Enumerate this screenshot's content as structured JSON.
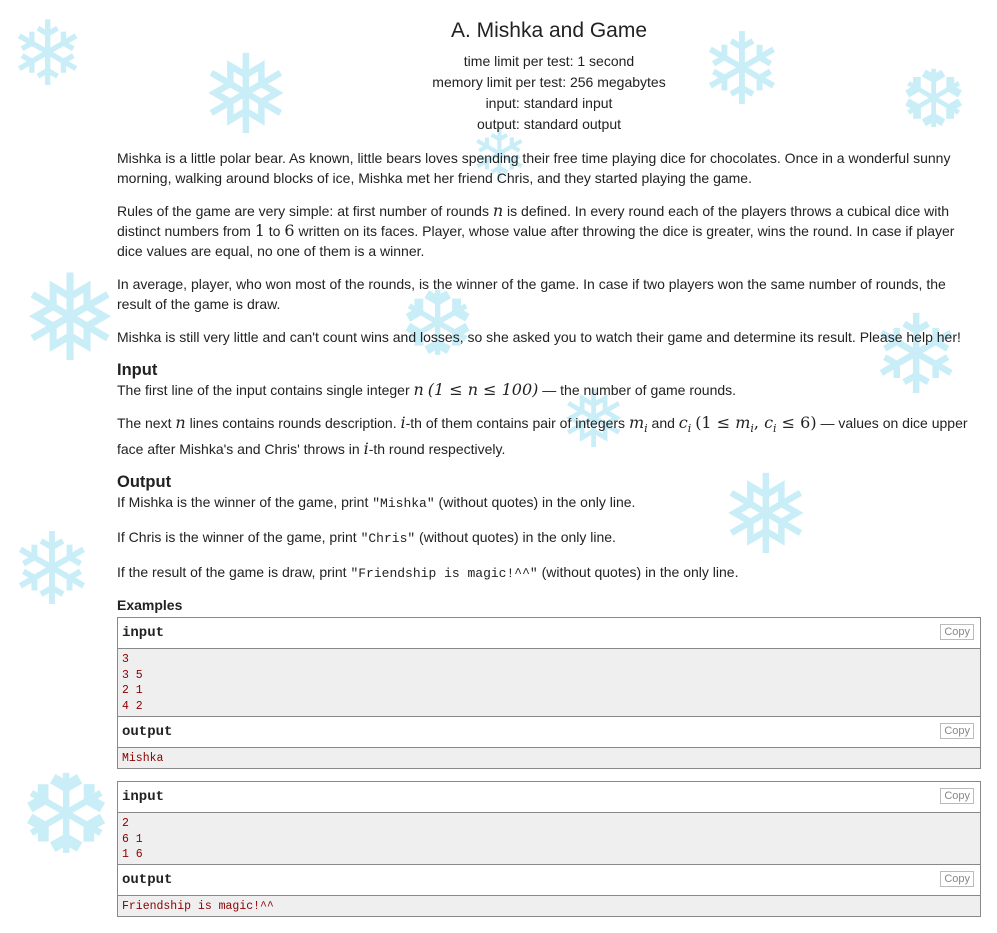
{
  "problem": {
    "title": "A. Mishka and Game",
    "limits": [
      "time limit per test: 1 second",
      "memory limit per test: 256 megabytes",
      "input: standard input",
      "output: standard output"
    ]
  },
  "statement": {
    "p1": "Mishka is a little polar bear. As known, little bears loves spending their free time playing dice for chocolates. Once in a wonderful sunny morning, walking around blocks of ice, Mishka met her friend Chris, and they started playing the game.",
    "p2a": "Rules of the game are very simple: at first number of rounds ",
    "p2b": " is defined. In every round each of the players throws a cubical dice with distinct numbers from ",
    "p2c": " to ",
    "p2d": " written on its faces. Player, whose value after throwing the dice is greater, wins the round. In case if player dice values are equal, no one of them is a winner.",
    "p3": "In average, player, who won most of the rounds, is the winner of the game. In case if two players won the same number of rounds, the result of the game is draw.",
    "p4": "Mishka is still very little and can't count wins and losses, so she asked you to watch their game and determine its result. Please help her!"
  },
  "math": {
    "n": "n",
    "one": "1",
    "six": "6",
    "n_range": "(1 ≤ n ≤ 100)",
    "i": "i",
    "mi": "m",
    "ci": "c",
    "sub_i": "i",
    "mc_range_a": "(1 ≤ ",
    "mc_range_b": ",  ",
    "mc_range_c": " ≤ 6)"
  },
  "input_section": {
    "title": "Input",
    "l1a": "The first line of the input contains single integer ",
    "l1b": " — the number of game rounds.",
    "l2a": "The next ",
    "l2b": " lines contains rounds description. ",
    "l2c": "-th of them contains pair of integers ",
    "l2d": " and ",
    "l2e": " — values on dice upper face after Mishka's and Chris' throws in ",
    "l2f": "-th round respectively."
  },
  "output_section": {
    "title": "Output",
    "o1a": "If Mishka is the winner of the game, print ",
    "o1code": "\"Mishka\"",
    "o1b": " (without quotes) in the only line.",
    "o2a": "If Chris is the winner of the game, print ",
    "o2code": "\"Chris\"",
    "o2b": " (without quotes) in the only line.",
    "o3a": "If the result of the game is draw, print ",
    "o3code": "\"Friendship is magic!^^\"",
    "o3b": " (without quotes) in the only line."
  },
  "examples": {
    "title": "Examples",
    "copy_label": "Copy",
    "input_label": "input",
    "output_label": "output",
    "ex1_input": [
      "3",
      "3 5",
      "2 1",
      "4 2"
    ],
    "ex1_output": [
      "Mishka"
    ],
    "ex2_input": [
      "2",
      "6 1",
      "1 6"
    ],
    "ex2_output": [
      "Friendship is magic!^^"
    ]
  },
  "colors": {
    "snowflake": "#c9eef7",
    "sample_bg": "#efefef",
    "sample_text": "#8b0000"
  }
}
